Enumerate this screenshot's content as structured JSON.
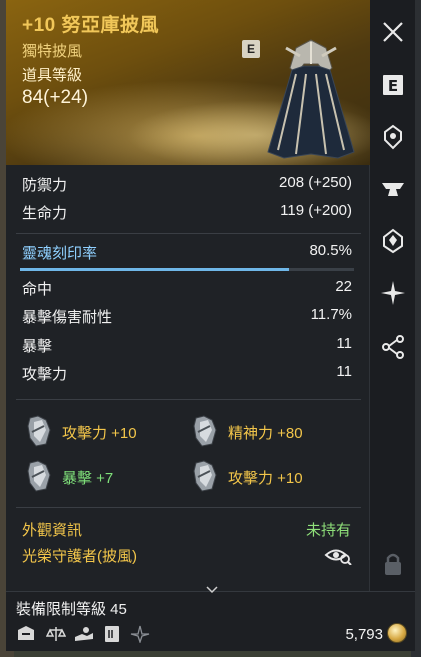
{
  "item": {
    "title": "+10 努亞庫披風",
    "subtype": "獨特披風",
    "item_level_label": "道具等級",
    "item_level_value": "84(+24)",
    "grade_badge": "E"
  },
  "main_stats": [
    {
      "label": "防禦力",
      "value": "208 (+250)"
    },
    {
      "label": "生命力",
      "value": "119 (+200)"
    }
  ],
  "soul": {
    "label": "靈魂刻印率",
    "value": "80.5%",
    "fill_fraction": 0.805
  },
  "sub_stats": [
    {
      "label": "命中",
      "value": "22"
    },
    {
      "label": "暴擊傷害耐性",
      "value": "11.7%"
    },
    {
      "label": "暴擊",
      "value": "11"
    },
    {
      "label": "攻擊力",
      "value": "11"
    }
  ],
  "options": [
    {
      "text": "攻擊力 +10",
      "color": "#f3c64a"
    },
    {
      "text": "精神力 +80",
      "color": "#f3c64a"
    },
    {
      "text": "暴擊 +7",
      "color": "#7fe07a"
    },
    {
      "text": "攻擊力 +10",
      "color": "#f3c64a"
    }
  ],
  "appearance": {
    "label": "外觀資訊",
    "status": "未持有",
    "name": "光榮守護者(披風)"
  },
  "footer": {
    "equip_limit": "裝備限制等級 45",
    "price": "5,793"
  },
  "sidebar": {
    "icons": [
      "close-icon",
      "enchant-e-icon",
      "crest-icon",
      "anvil-icon",
      "gem-icon",
      "star-icon",
      "share-icon",
      "lock-icon"
    ]
  }
}
